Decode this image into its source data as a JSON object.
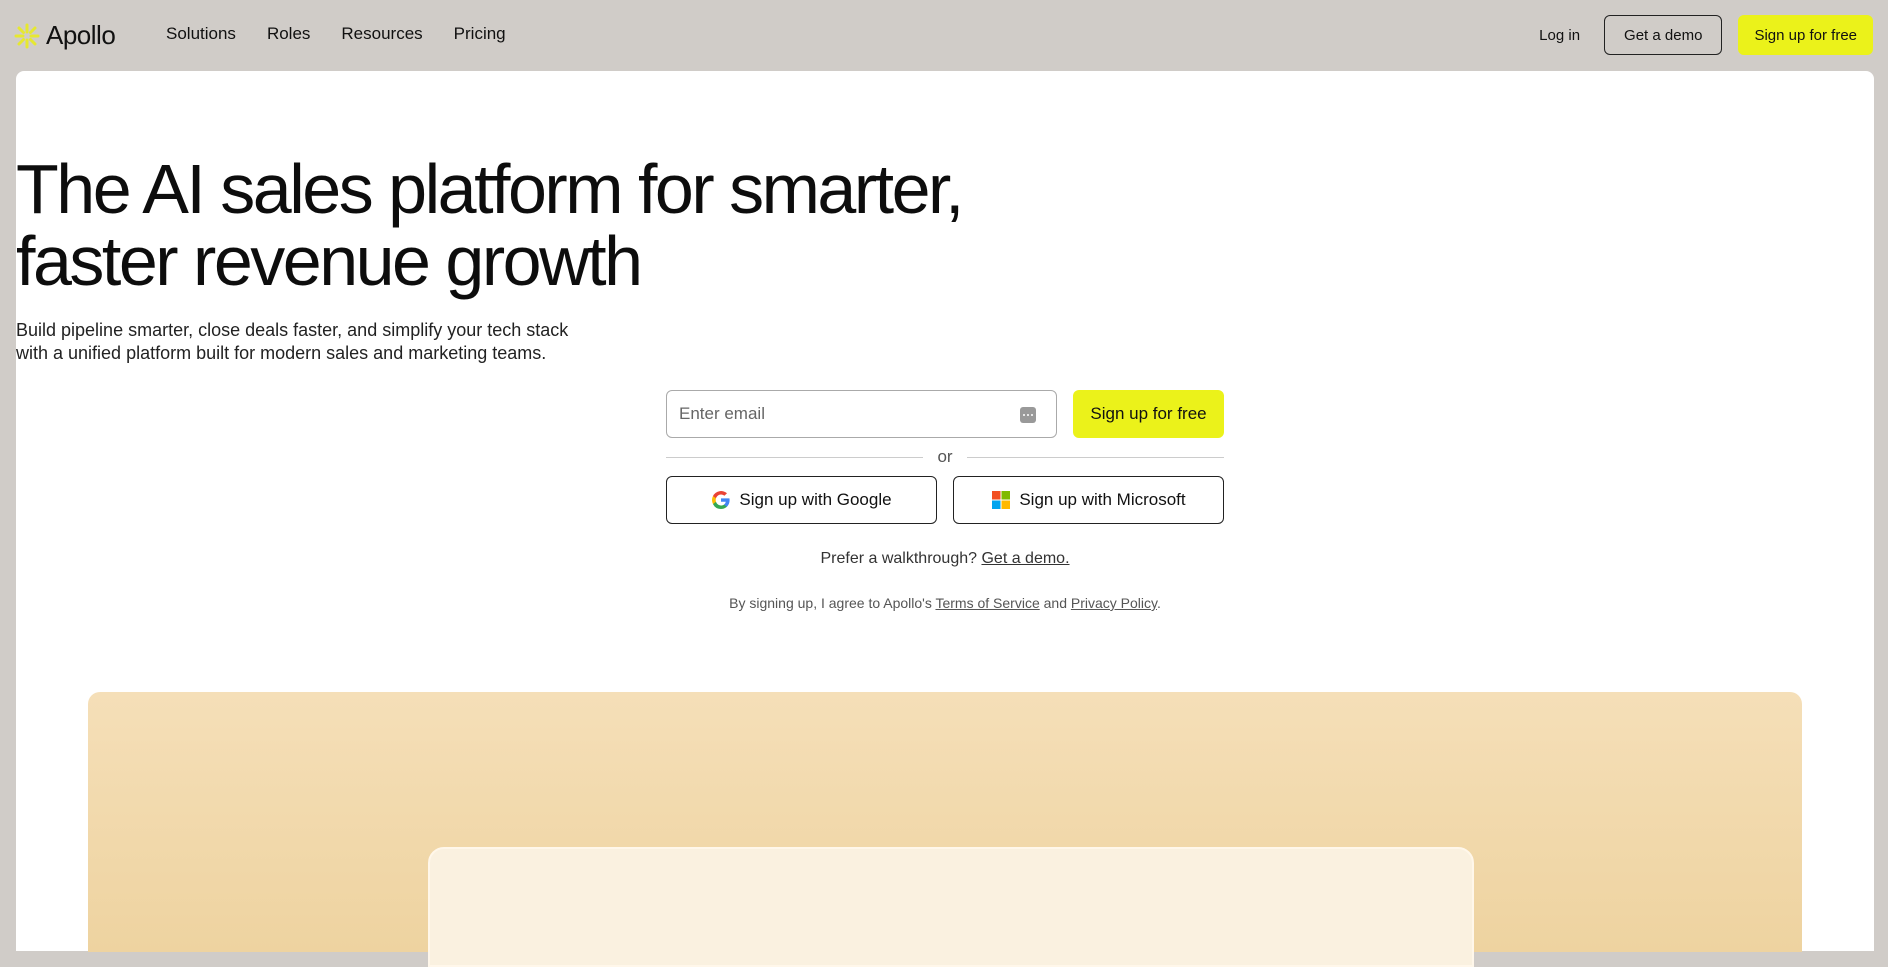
{
  "brand": {
    "name": "Apollo",
    "accent": "#ebf21a"
  },
  "nav": {
    "items": [
      "Solutions",
      "Roles",
      "Resources",
      "Pricing"
    ]
  },
  "header_actions": {
    "login": "Log in",
    "demo": "Get a demo",
    "signup": "Sign up for free"
  },
  "hero": {
    "headline_line1": "The AI sales platform for smarter,",
    "headline_line2": "faster revenue growth",
    "subhead_line1": "Build pipeline smarter, close deals faster, and simplify your tech stack",
    "subhead_line2": "with a unified platform built for modern sales and marketing teams."
  },
  "form": {
    "email_placeholder": "Enter email",
    "email_value": "",
    "signup_label": "Sign up for free",
    "divider_text": "or",
    "google_label": "Sign up with Google",
    "microsoft_label": "Sign up with Microsoft"
  },
  "walkthrough": {
    "prefix": "Prefer a walkthrough?",
    "link": "Get a demo."
  },
  "legal": {
    "prefix": "By signing up, I agree to Apollo's",
    "terms": "Terms of Service",
    "and": "and",
    "privacy": "Privacy Policy",
    "suffix": "."
  },
  "icons": {
    "logo": "apollo-asterisk-icon",
    "password_manager": "password-dots-icon",
    "google": "google-g-icon",
    "microsoft": "microsoft-squares-icon"
  }
}
